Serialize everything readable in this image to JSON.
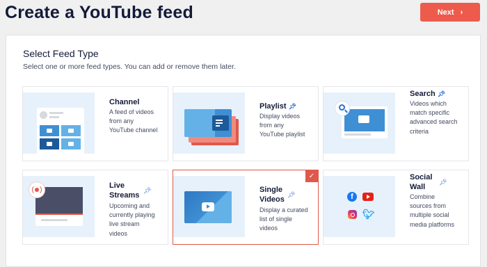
{
  "header": {
    "title": "Create a YouTube feed",
    "next_label": "Next",
    "next_icon": "chevron-right-icon"
  },
  "panel": {
    "title": "Select Feed Type",
    "subtitle": "Select one or more feed types. You can add or remove them later."
  },
  "cards": [
    {
      "name": "Channel",
      "desc": "A feed of videos from any YouTube channel",
      "pro": false,
      "selected": false
    },
    {
      "name": "Playlist",
      "desc": "Display videos from any YouTube playlist",
      "pro": true,
      "selected": false
    },
    {
      "name": "Search",
      "desc": "Videos which match specific advanced search criteria",
      "pro": true,
      "selected": false
    },
    {
      "name_line1": "Live",
      "name_line2": "Streams",
      "desc": "Upcoming and currently playing live stream videos",
      "pro": true,
      "selected": false
    },
    {
      "name_line1": "Single",
      "name_line2": "Videos",
      "desc": "Display a curated list of single videos",
      "pro": true,
      "selected": true
    },
    {
      "name_line1": "Social",
      "name_line2": "Wall",
      "desc": "Combine sources from multiple social media platforms",
      "pro": true,
      "selected": false
    }
  ],
  "colors": {
    "accent": "#ec5b4c",
    "blue": "#2c6fd6",
    "thumb_bg": "#e6f1fb"
  }
}
